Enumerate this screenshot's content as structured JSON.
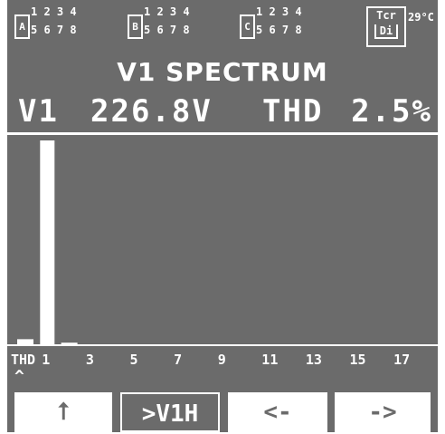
{
  "status": {
    "groups": [
      {
        "letter": "A",
        "top_row": "1 2 3 4",
        "bottom_row": "5 6 7 8"
      },
      {
        "letter": "B",
        "top_row": "1 2 3 4",
        "bottom_row": "5 6 7 8"
      },
      {
        "letter": "C",
        "top_row": "1 2 3 4",
        "bottom_row": "5 6 7 8"
      }
    ],
    "tcr_top": "Tcr",
    "tcr_bottom": "Di",
    "temperature": "29°C"
  },
  "title": "V1 SPECTRUM",
  "measurement": {
    "channel": "V1",
    "value": "226.8V",
    "thd_label": "THD",
    "thd_value": "2.5%"
  },
  "chart_data": {
    "type": "bar",
    "categories": [
      "THD",
      "1",
      "2",
      "3",
      "4",
      "5",
      "6",
      "7",
      "8",
      "9",
      "10",
      "11",
      "12",
      "13",
      "14",
      "15",
      "16",
      "17"
    ],
    "values": [
      2.5,
      100,
      0.8,
      0,
      0,
      0,
      0,
      0,
      0,
      0,
      0,
      0,
      0,
      0,
      0,
      0,
      0,
      0
    ],
    "tick_labels": [
      "THD",
      "1",
      "3",
      "5",
      "7",
      "9",
      "11",
      "13",
      "15",
      "17"
    ],
    "ylim": [
      0,
      100
    ],
    "grid": false,
    "color": "#ffffff"
  },
  "cursor_glyph": "^",
  "softkeys": {
    "up": "⭡",
    "mode": ">V1H",
    "left": "<-",
    "right": "->"
  }
}
